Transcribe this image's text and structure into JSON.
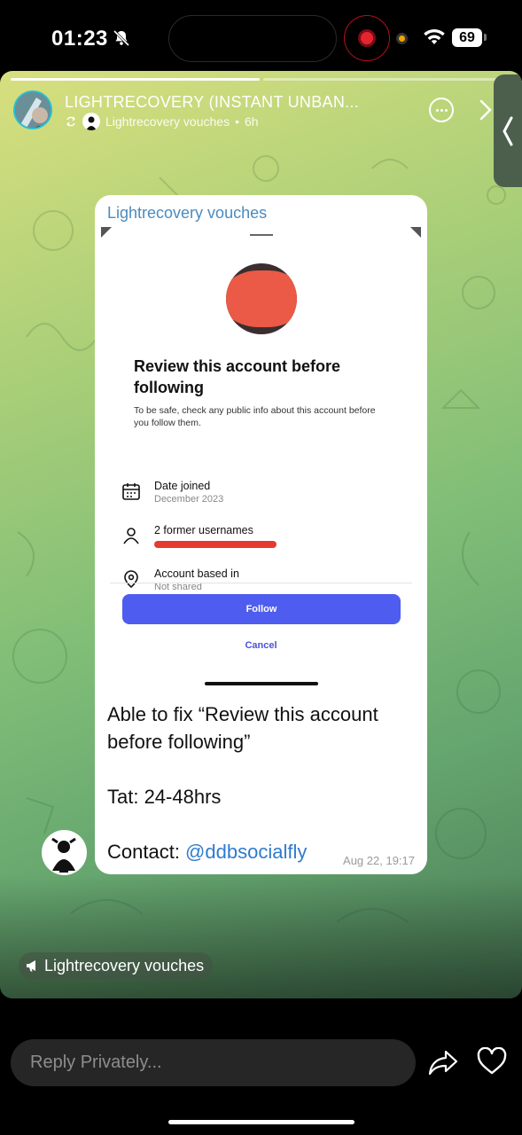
{
  "status_bar": {
    "time": "01:23",
    "battery": "69"
  },
  "story": {
    "progress_segments": [
      {
        "state": "done"
      },
      {
        "state": "current"
      }
    ],
    "channel_title": "LIGHTRECOVERY (INSTANT UNBAN...",
    "repost_source": "Lightrecovery vouches",
    "age": "6h"
  },
  "message": {
    "sender": "Lightrecovery vouches",
    "screenshot": {
      "heading": "Review this account before following",
      "description": "To be safe, check any public info about this account before you follow them.",
      "rows": [
        {
          "icon": "calendar-icon",
          "label": "Date joined",
          "value": "December 2023"
        },
        {
          "icon": "person-icon",
          "label": "2 former usernames",
          "value": ""
        },
        {
          "icon": "location-pin-icon",
          "label": "Account based in",
          "value": "Not shared"
        }
      ],
      "follow_label": "Follow",
      "cancel_label": "Cancel"
    },
    "line1": "Able to fix “Review this account before following”",
    "line2": "Tat: 24-48hrs",
    "contact_prefix": "Contact: ",
    "contact_handle": "@ddbsocialfly",
    "timestamp": "Aug 22, 19:17"
  },
  "channel_chip": {
    "icon": "megaphone-icon",
    "label": "Lightrecovery vouches"
  },
  "bottom_bar": {
    "reply_placeholder": "Reply Privately...",
    "share_icon": "share-icon",
    "like_icon": "heart-icon"
  },
  "colors": {
    "accent_blue": "#4f5cf0",
    "link_blue": "#2f7bd0",
    "sender_blue": "#4a8bbf",
    "record_red": "#e5242f",
    "redaction_red": "#ea5a47"
  }
}
